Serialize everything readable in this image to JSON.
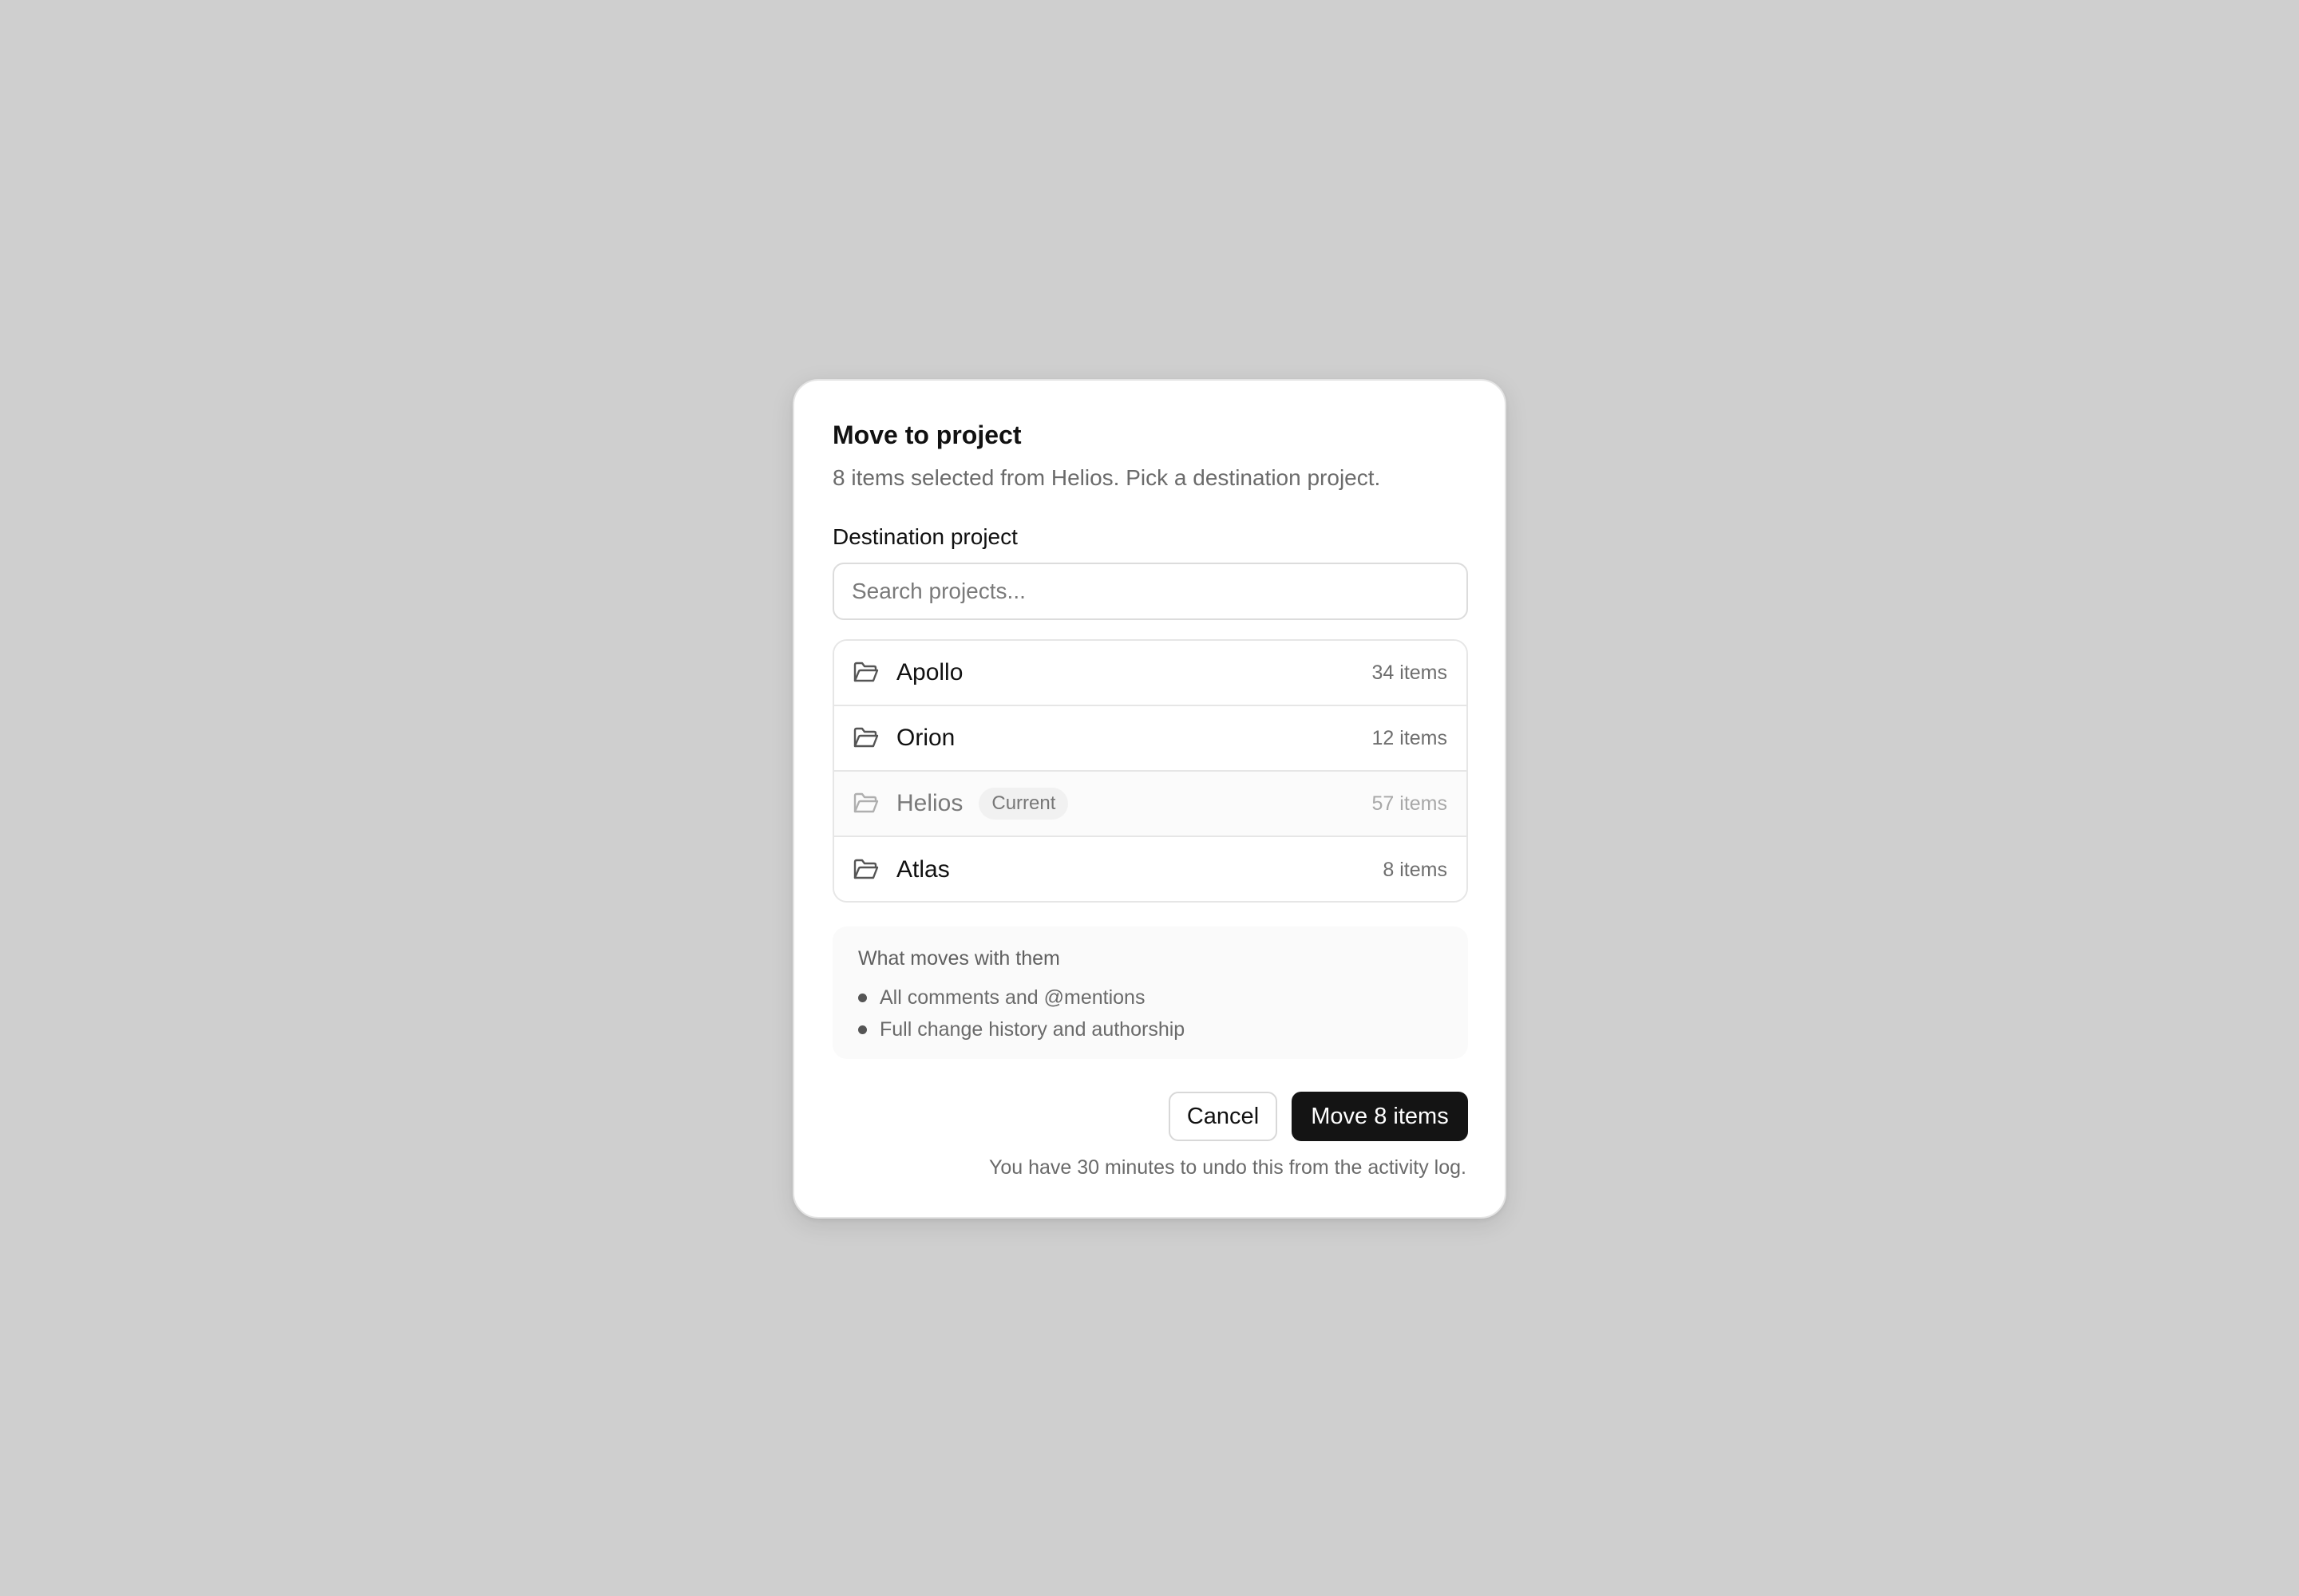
{
  "dialog": {
    "title": "Move to project",
    "subtitle": "8 items selected from Helios. Pick a destination project."
  },
  "destination": {
    "label": "Destination project",
    "search_placeholder": "Search projects...",
    "search_value": ""
  },
  "projects": [
    {
      "name": "Apollo",
      "count": "34 items",
      "icon": "folder-icon",
      "current": false,
      "badge": ""
    },
    {
      "name": "Orion",
      "count": "12 items",
      "icon": "folder-icon",
      "current": false,
      "badge": ""
    },
    {
      "name": "Helios",
      "count": "57 items",
      "icon": "folder-icon",
      "current": true,
      "badge": "Current"
    },
    {
      "name": "Atlas",
      "count": "8 items",
      "icon": "folder-icon",
      "current": false,
      "badge": ""
    }
  ],
  "info": {
    "title": "What moves with them",
    "items": [
      "All comments and @mentions",
      "Full change history and authorship"
    ]
  },
  "actions": {
    "cancel_label": "Cancel",
    "confirm_label": "Move 8 items"
  },
  "footnote": "You have 30 minutes to undo this from the activity log.",
  "colors": {
    "backdrop": "#cfcfcf",
    "primary_button": "#141414",
    "muted_text": "#6b6b6b"
  }
}
